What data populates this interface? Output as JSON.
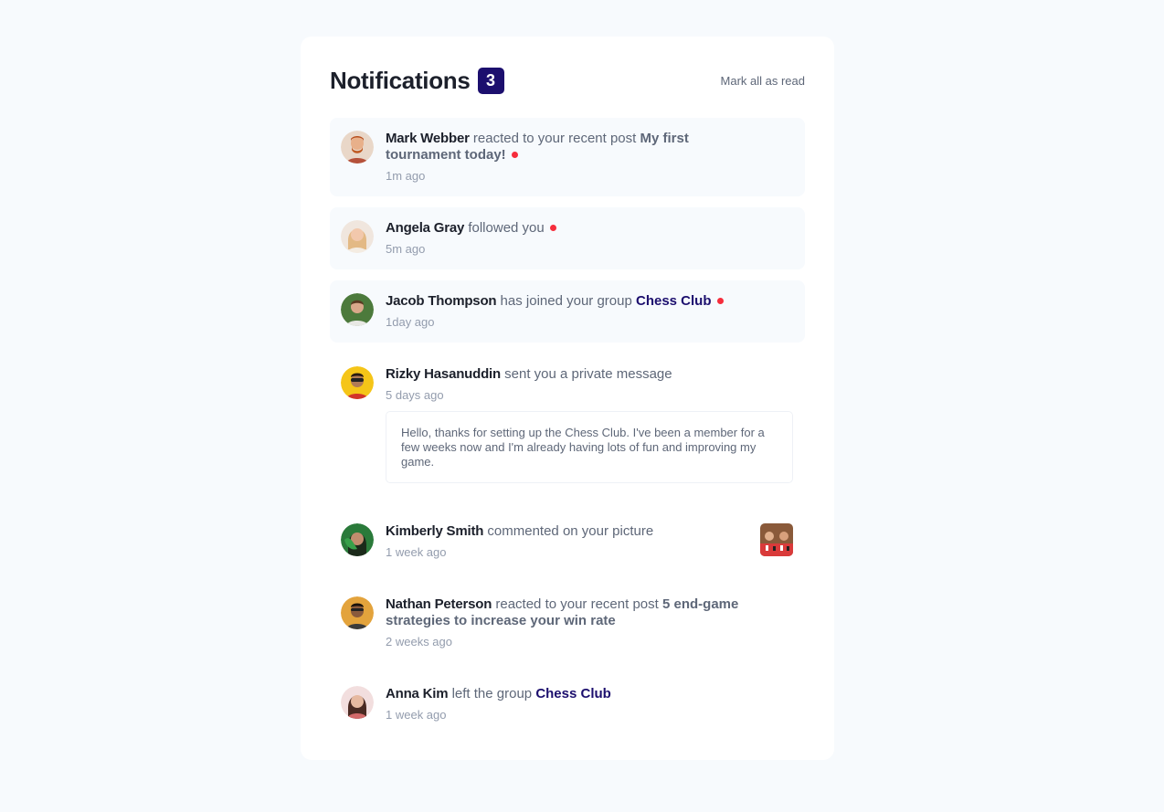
{
  "header": {
    "title": "Notifications",
    "unread_count": "3",
    "mark_all_label": "Mark all as read"
  },
  "notifications": [
    {
      "name": "Mark Webber",
      "action": " reacted to your recent post ",
      "post": "My first tournament today!",
      "time": "1m ago",
      "unread": true
    },
    {
      "name": "Angela Gray",
      "action": " followed you",
      "time": "5m ago",
      "unread": true
    },
    {
      "name": "Jacob Thompson",
      "action": " has joined your group ",
      "group": "Chess Club",
      "time": "1day ago",
      "unread": true
    },
    {
      "name": "Rizky Hasanuddin",
      "action": " sent you a private message",
      "time": "5 days ago",
      "message": "Hello, thanks for setting up the Chess Club. I've been a member for a few weeks now and I'm already having lots of fun and improving my game.",
      "unread": false
    },
    {
      "name": "Kimberly Smith",
      "action": " commented on your picture",
      "time": "1 week ago",
      "unread": false
    },
    {
      "name": "Nathan Peterson",
      "action": " reacted to your recent post ",
      "post": "5 end-game strategies to increase your win rate",
      "time": "2 weeks ago",
      "unread": false
    },
    {
      "name": "Anna Kim",
      "action": " left the group ",
      "group": "Chess Club",
      "time": "1 week ago",
      "unread": false
    }
  ],
  "colors": {
    "background": "#f7fafd",
    "accent": "#1c0f6e",
    "unread_dot": "#f62d3c",
    "unread_bg": "#f7fafd"
  }
}
